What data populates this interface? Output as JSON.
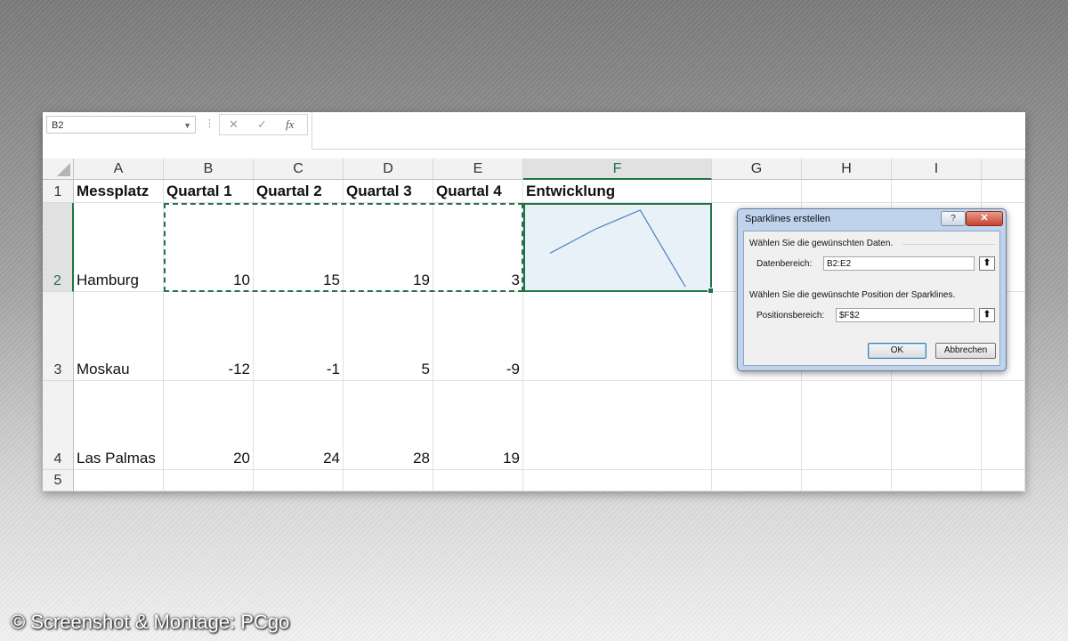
{
  "formula_bar": {
    "name_box": "B2",
    "name_box_dropdown_icon": "chevron-down-icon",
    "separator": "⋮",
    "cancel_icon": "✕",
    "enter_icon": "✓",
    "function_icon": "fx",
    "formula": ""
  },
  "columns": [
    "A",
    "B",
    "C",
    "D",
    "E",
    "F",
    "G",
    "H",
    "I"
  ],
  "rows": [
    "1",
    "2",
    "3",
    "4",
    "5"
  ],
  "header_row": [
    "Messplatz",
    "Quartal 1",
    "Quartal 2",
    "Quartal 3",
    "Quartal 4",
    "Entwicklung"
  ],
  "data_rows": [
    {
      "name": "Hamburg",
      "q1": "10",
      "q2": "15",
      "q3": "19",
      "q4": "3"
    },
    {
      "name": "Moskau",
      "q1": "-12",
      "q2": "-1",
      "q3": "5",
      "q4": "-9"
    },
    {
      "name": "Las Palmas",
      "q1": "20",
      "q2": "24",
      "q3": "28",
      "q4": "19"
    }
  ],
  "sparkline": {
    "values": [
      10,
      15,
      19,
      3
    ],
    "color": "#4a7fb5"
  },
  "dialog": {
    "title": "Sparklines erstellen",
    "help": "?",
    "close": "✕",
    "section_data": "Wählen Sie die gewünschten Daten.",
    "data_range_label": "Datenbereich:",
    "data_range_value": "B2:E2",
    "section_position": "Wählen Sie die gewünschte Position der Sparklines.",
    "position_label": "Positionsbereich:",
    "position_value": "$F$2",
    "collapse_icon": "⬆",
    "ok": "OK",
    "cancel": "Abbrechen"
  },
  "watermark": "© Screenshot & Montage: PCgo",
  "colors": {
    "excel_green": "#217346",
    "selection_fill": "#e8f0f8"
  }
}
